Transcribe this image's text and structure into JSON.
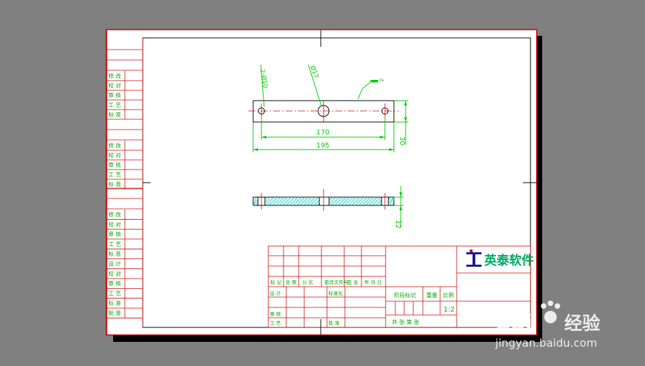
{
  "colors": {
    "background": "#808080",
    "paper": "#ffffff",
    "frame": "#cc0000",
    "dimension": "#00cc00",
    "hatch": "#00cccc",
    "part": "#000000",
    "center": "#cc0000",
    "logo_text": "#00aa66",
    "logo_mark": "#1a1a99"
  },
  "side_table": {
    "group_a": [
      "修 改",
      "校 对",
      "审 核",
      "工 艺",
      "标 准"
    ],
    "group_b": [
      "修 改",
      "校 对",
      "审 核",
      "工 艺",
      "标 准"
    ],
    "group_c": [
      "修 改",
      "校 对",
      "审 核",
      "工 艺",
      "标 准",
      "设 计",
      "校 对",
      "审 核",
      "工 艺",
      "标 准",
      "批 准"
    ]
  },
  "drawing": {
    "front_view": {
      "leader_holes": "2-Ø10",
      "leader_center": "Ø17",
      "roughness_note": "Ra",
      "dim_hole_spacing": "170",
      "dim_total_length": "195",
      "dim_height": "30"
    },
    "section_view": {
      "dim_thickness": "12"
    }
  },
  "title_block": {
    "header_row": [
      "标 记",
      "处 数",
      "分 区",
      "更改文件号",
      "签 名",
      "年 月 日"
    ],
    "designer_label": "设 计",
    "standard_label": "标准化",
    "review_label": "审 核",
    "process_label": "工 艺",
    "approve_label": "批 准",
    "stage_label": "阶段标记",
    "weight_label": "重量",
    "scale_label": "比例",
    "scale_value": "1:2",
    "sheet_label": "共   张   第   张",
    "company_name": "英泰软件",
    "company_mark": "IT"
  },
  "watermark": {
    "brand": "Bai",
    "brand2": "经验",
    "url": "jingyan.baidu.com"
  }
}
